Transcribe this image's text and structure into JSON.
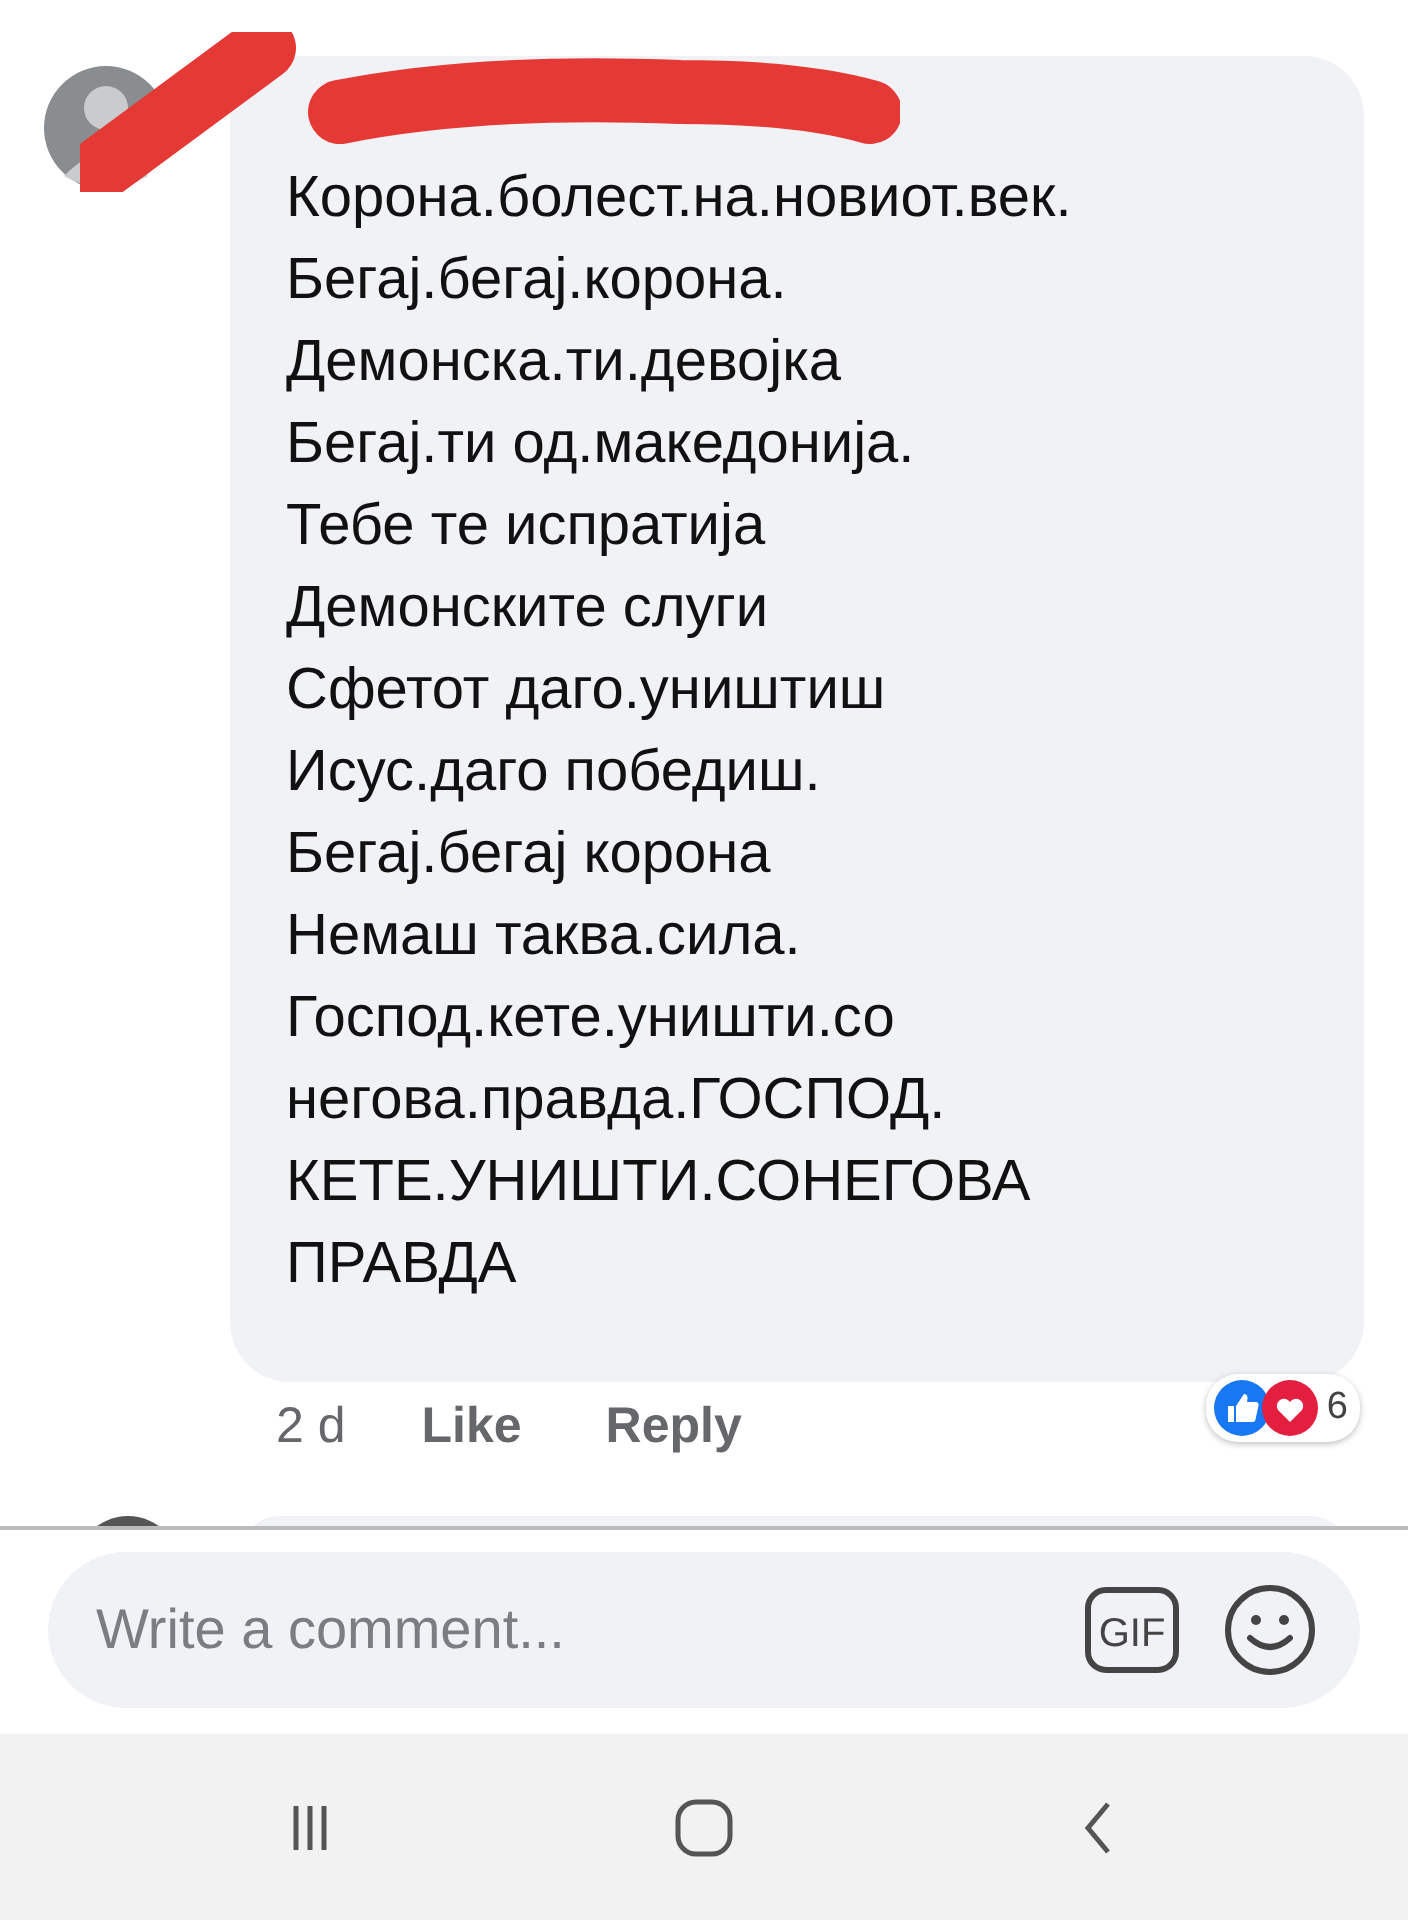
{
  "comment": {
    "lines": [
      "Корона.болест.на.новиот.век.",
      "Бегај.бегај.корона.",
      "Демонска.ти.девојка",
      "Бегај.ти од.македонија.",
      "Тебе те испратија",
      "Демонските слуги",
      "Сфетот даго.уништиш",
      "Исус.даго победиш.",
      "Бегај.бегај корона",
      "Немаш таква.сила.",
      "Господ.кете.уништи.со",
      "негова.правда.ГОСПОД.",
      "КЕТЕ.УНИШТИ.СОНЕГОВА",
      "ПРАВДА"
    ],
    "time": "2 d",
    "actions": [
      "Like",
      "Reply"
    ],
    "reaction_count": "6"
  },
  "composer": {
    "placeholder": "Write a comment...",
    "gif_label": "GIF"
  }
}
